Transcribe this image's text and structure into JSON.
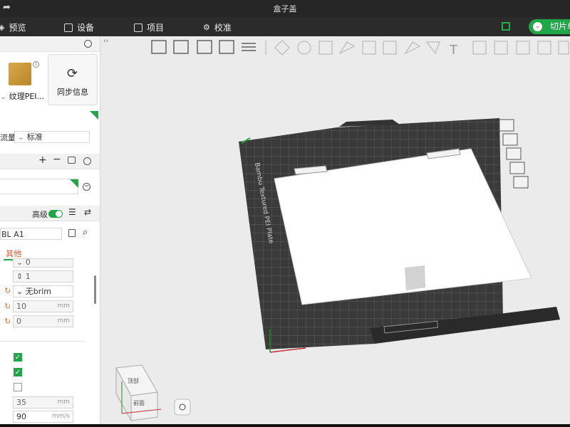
{
  "window": {
    "title": "盒子盖"
  },
  "menu": {
    "preview": "预览",
    "device": "设备",
    "project": "项目",
    "calibrate": "校准",
    "slice_button": "切片单"
  },
  "plate": {
    "plate_label": "纹理PEI...",
    "sync_label": "同步信息"
  },
  "filament": {
    "flow_label": "流量",
    "flow_value": "标准"
  },
  "process": {
    "advanced_label": "高级",
    "printer_preset": "BL A1",
    "active_tab": "其他"
  },
  "settings": {
    "top_value": "0",
    "stepper_value": "1",
    "brim_value": "无brim",
    "brim_width": "10",
    "brim_gap": "0",
    "unit_mm": "mm",
    "speed_35": "35",
    "speed_90": "90",
    "unit_mms": "mm/s"
  },
  "viewport": {
    "plate_text": "Bambu Textured PEI Plate",
    "view_top": "顶部",
    "view_front": "前面"
  },
  "colors": {
    "accent": "#1fa646",
    "plate_dark": "#3a3a3a",
    "orange": "#e4732b"
  }
}
